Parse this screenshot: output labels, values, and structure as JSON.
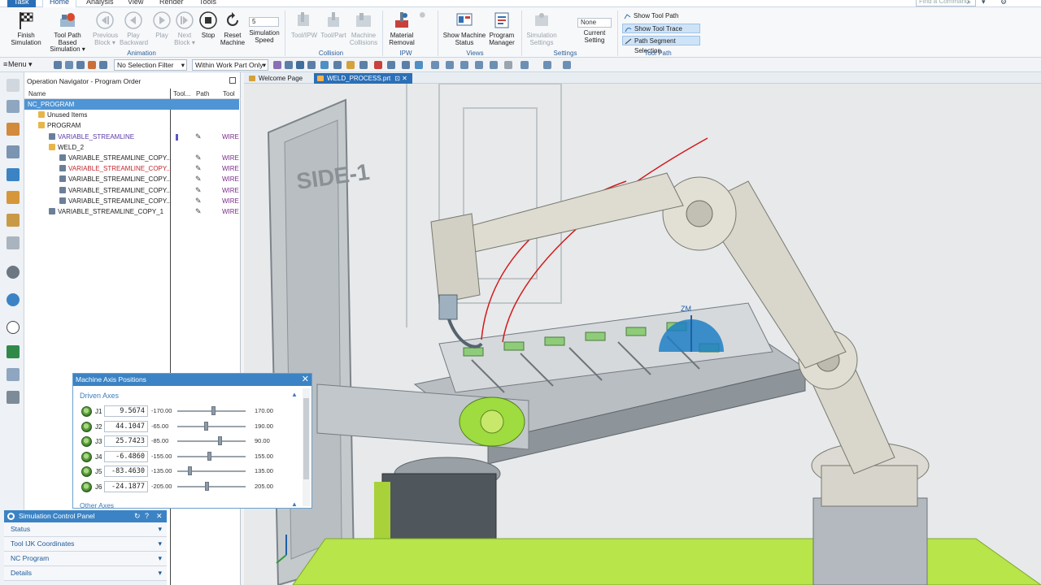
{
  "tabs": {
    "task": "Task",
    "home": "Home",
    "analysis": "Analysis",
    "view": "View",
    "render": "Render",
    "tools": "Tools",
    "search_placeholder": "Find a Command"
  },
  "ribbon": {
    "animation": {
      "label": "Animation",
      "finish": "Finish\nSimulation",
      "toolpath_based": "Tool Path Based\nSimulation ▾",
      "prev_block": "Previous\nBlock ▾",
      "play_backward": "Play\nBackward",
      "play": "Play",
      "next_block": "Next\nBlock ▾",
      "stop": "Stop",
      "reset": "Reset\nMachine",
      "speed_value": "5",
      "speed_label": "Simulation\nSpeed"
    },
    "collision": {
      "label": "Collision",
      "tool_ipw": "Tool/IPW",
      "tool_part": "Tool/Part",
      "machine_collisions": "Machine\nCollisions"
    },
    "ipw": {
      "label": "IPW",
      "material_removal": "Material\nRemoval"
    },
    "views": {
      "label": "Views",
      "show_machine_status": "Show Machine\nStatus",
      "program_manager": "Program\nManager"
    },
    "settings": {
      "label": "Settings",
      "simulation_settings": "Simulation\nSettings",
      "none_value": "None",
      "current_setting": "Current\nSetting"
    },
    "toolpath": {
      "label": "Tool Path",
      "show_tool_path": "Show Tool Path",
      "show_tool_trace": "Show Tool Trace",
      "path_segment_selection": "Path Segment Selection"
    }
  },
  "cmdbar": {
    "menu": "Menu ▾",
    "selection_filter": "No Selection Filter",
    "scope": "Within Work Part Only"
  },
  "navigator": {
    "title": "Operation Navigator - Program Order",
    "columns": {
      "name": "Name",
      "tool": "Tool...",
      "path": "Path",
      "toolcol": "Tool"
    },
    "rows": [
      {
        "name": "NC_PROGRAM",
        "indent": 0,
        "icon": "",
        "path": "",
        "tool": ""
      },
      {
        "name": "Unused Items",
        "indent": 1,
        "icon": "folder",
        "path": "",
        "tool": ""
      },
      {
        "name": "PROGRAM",
        "indent": 1,
        "icon": "folder",
        "path": "",
        "tool": ""
      },
      {
        "name": "VARIABLE_STREAMLINE",
        "indent": 2,
        "icon": "op",
        "path": "✎",
        "tool": "WIRE",
        "color": "#5a3aa8"
      },
      {
        "name": "WELD_2",
        "indent": 2,
        "icon": "folder",
        "path": "",
        "tool": ""
      },
      {
        "name": "VARIABLE_STREAMLINE_COPY...",
        "indent": 3,
        "icon": "op",
        "path": "✎",
        "tool": "WIRE"
      },
      {
        "name": "VARIABLE_STREAMLINE_COPY...",
        "indent": 3,
        "icon": "op",
        "path": "✎",
        "tool": "WIRE",
        "color": "#c0262e"
      },
      {
        "name": "VARIABLE_STREAMLINE_COPY...",
        "indent": 3,
        "icon": "op",
        "path": "✎",
        "tool": "WIRE"
      },
      {
        "name": "VARIABLE_STREAMLINE_COPY...",
        "indent": 3,
        "icon": "op",
        "path": "✎",
        "tool": "WIRE"
      },
      {
        "name": "VARIABLE_STREAMLINE_COPY...",
        "indent": 3,
        "icon": "op",
        "path": "✎",
        "tool": "WIRE"
      },
      {
        "name": "VARIABLE_STREAMLINE_COPY_1",
        "indent": 2,
        "icon": "op",
        "path": "✎",
        "tool": "WIRE"
      }
    ]
  },
  "viewport": {
    "tabs": [
      "Welcome Page",
      "WELD_PROCESS.prt"
    ],
    "side_label": "SIDE-1",
    "axis_label": "ZM"
  },
  "axis_dialog": {
    "title": "Machine Axis Positions",
    "driven_label": "Driven Axes",
    "other_label": "Other Axes",
    "axes": [
      {
        "name": "J1",
        "value": "9.5674",
        "min": "-170.00",
        "max": "170.00",
        "pos": 0.53
      },
      {
        "name": "J2",
        "value": "44.1047",
        "min": "-65.00",
        "max": "190.00",
        "pos": 0.43
      },
      {
        "name": "J3",
        "value": "25.7423",
        "min": "-85.00",
        "max": "90.00",
        "pos": 0.63
      },
      {
        "name": "J4",
        "value": "-6.4860",
        "min": "-155.00",
        "max": "155.00",
        "pos": 0.48
      },
      {
        "name": "J5",
        "value": "-83.4630",
        "min": "-135.00",
        "max": "135.00",
        "pos": 0.19
      },
      {
        "name": "J6",
        "value": "-24.1877",
        "min": "-205.00",
        "max": "205.00",
        "pos": 0.44
      }
    ]
  },
  "sim_panel": {
    "title": "Simulation Control Panel",
    "sections": [
      "Status",
      "Tool IJK Coordinates",
      "NC Program",
      "Details"
    ]
  }
}
